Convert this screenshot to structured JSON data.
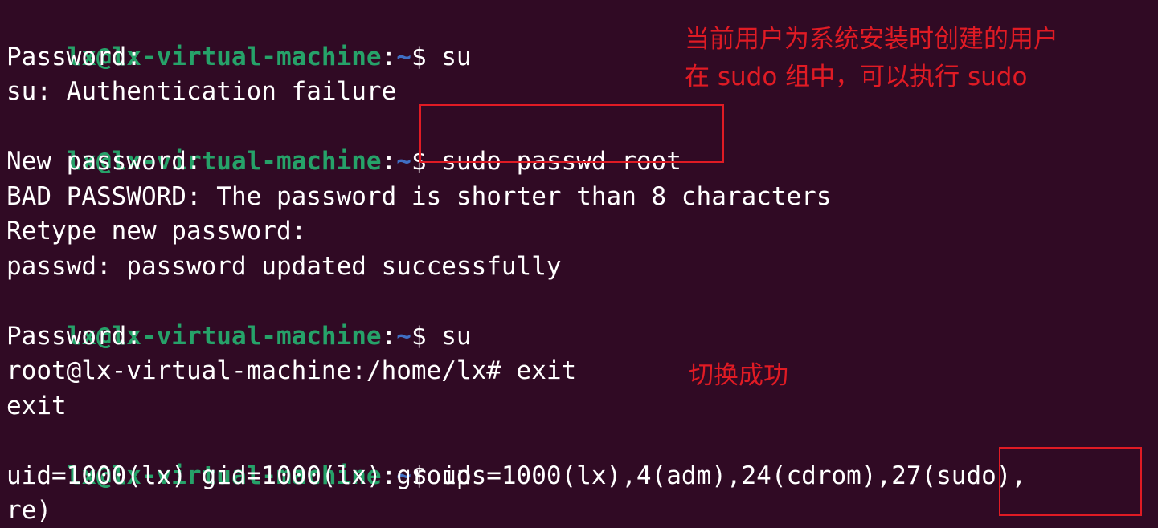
{
  "terminal": {
    "lines": [
      {
        "user": "lx@lx-virtual-machine",
        "sep": ":",
        "path": "~",
        "symbol": "$ ",
        "cmd": "su"
      },
      {
        "text": "Password:"
      },
      {
        "text": "su: Authentication failure"
      },
      {
        "user": "lx@lx-virtual-machine",
        "sep": ":",
        "path": "~",
        "symbol": "$ ",
        "cmd": "sudo passwd root"
      },
      {
        "text": "New password:"
      },
      {
        "text": "BAD PASSWORD: The password is shorter than 8 characters"
      },
      {
        "text": "Retype new password:"
      },
      {
        "text": "passwd: password updated successfully"
      },
      {
        "user": "lx@lx-virtual-machine",
        "sep": ":",
        "path": "~",
        "symbol": "$ ",
        "cmd": "su"
      },
      {
        "text": "Password:"
      },
      {
        "text": "root@lx-virtual-machine:/home/lx# exit"
      },
      {
        "text": "exit"
      },
      {
        "user": "lx@lx-virtual-machine",
        "sep": ":",
        "path": "~",
        "symbol": "$ ",
        "cmd": "id"
      },
      {
        "text": "uid=1000(lx) gid=1000(lx) groups=1000(lx),4(adm),24(cdrom),27(sudo),"
      },
      {
        "text": "re)"
      }
    ]
  },
  "annotations": {
    "note_line1": "当前用户为系统安装时创建的用户",
    "note_line2": "在 sudo 组中，可以执行 sudo",
    "note_switch": "切换成功"
  },
  "colors": {
    "background": "#300a24",
    "prompt_user": "#26a269",
    "prompt_path": "#3f6fc4",
    "text": "#ffffff",
    "annotation": "#e01b24"
  }
}
